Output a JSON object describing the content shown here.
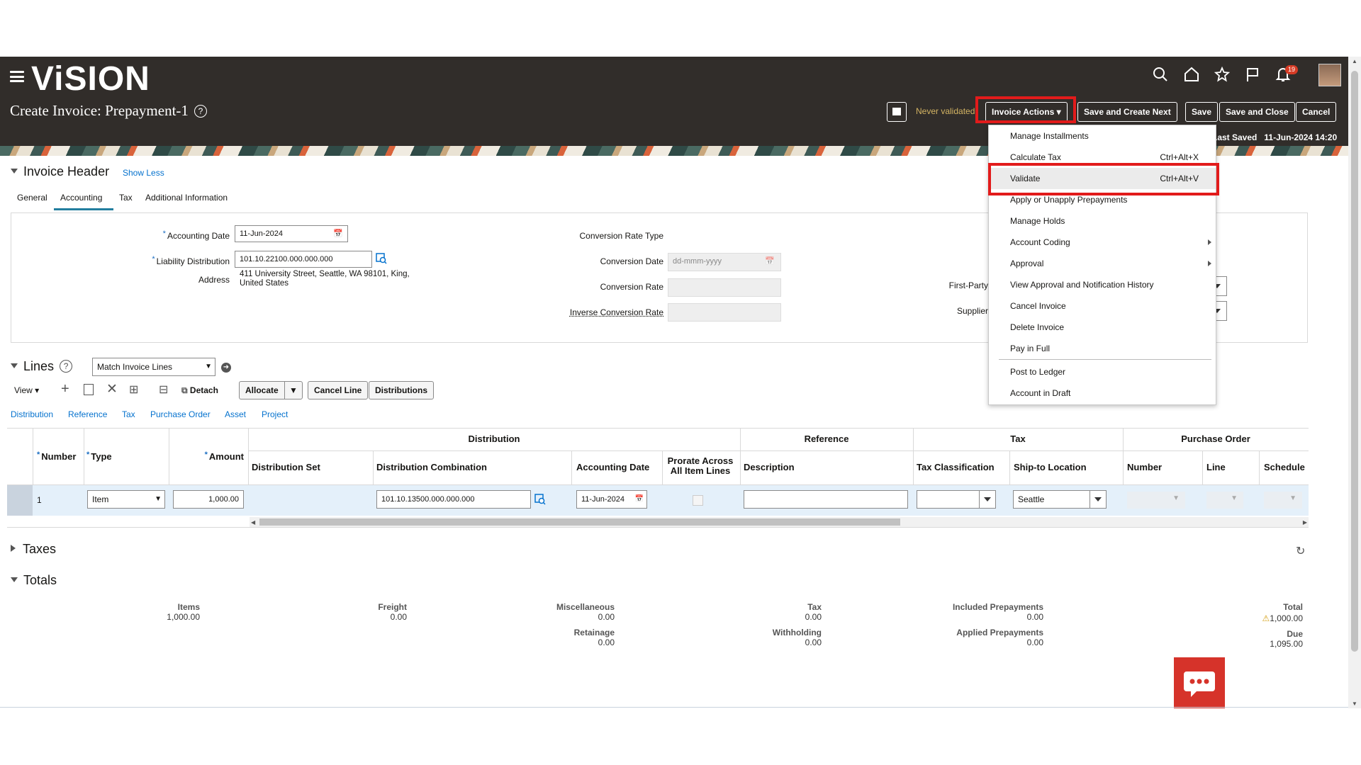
{
  "app": {
    "logo": "ViSION",
    "page_title": "Create Invoice: Prepayment-1",
    "notifications_count": "19"
  },
  "header_actions": {
    "status": "Never validated",
    "invoice_actions": "Invoice Actions",
    "save_create_next": "Save and Create Next",
    "save": "Save",
    "save_close": "Save and Close",
    "cancel": "Cancel",
    "last_saved_label": "Last Saved",
    "last_saved_value": "11-Jun-2024 14:20"
  },
  "invoice_header": {
    "title": "Invoice Header",
    "show_less": "Show Less",
    "tabs": [
      "General",
      "Accounting",
      "Tax",
      "Additional Information"
    ],
    "accounting_date_label": "Accounting Date",
    "accounting_date": "11-Jun-2024",
    "liability_label": "Liability Distribution",
    "liability_value": "101.10.22100.000.000.000",
    "address_label": "Address",
    "address_line1": "411 University Street, Seattle, WA 98101, King,",
    "address_line2": "United States",
    "conv_rate_type_label": "Conversion Rate Type",
    "conv_date_label": "Conversion Date",
    "conv_date_placeholder": "dd-mmm-yyyy",
    "conv_rate_label": "Conversion Rate",
    "inverse_rate_label": "Inverse Conversion Rate",
    "first_party_label": "First-Party",
    "supplier_label": "Supplier"
  },
  "menu": {
    "items": [
      {
        "label": "Manage Installments",
        "shortcut": ""
      },
      {
        "label": "Calculate Tax",
        "shortcut": "Ctrl+Alt+X"
      },
      {
        "label": "Validate",
        "shortcut": "Ctrl+Alt+V"
      },
      {
        "label": "Apply or Unapply Prepayments",
        "shortcut": ""
      },
      {
        "label": "Manage Holds",
        "shortcut": ""
      },
      {
        "label": "Account Coding",
        "shortcut": ""
      },
      {
        "label": "Approval",
        "shortcut": ""
      },
      {
        "label": "View Approval and Notification History",
        "shortcut": ""
      },
      {
        "label": "Cancel Invoice",
        "shortcut": ""
      },
      {
        "label": "Delete Invoice",
        "shortcut": ""
      },
      {
        "label": "Pay in Full",
        "shortcut": ""
      },
      {
        "label": "Post to Ledger",
        "shortcut": ""
      },
      {
        "label": "Account in Draft",
        "shortcut": ""
      }
    ]
  },
  "lines": {
    "title": "Lines",
    "match_select": "Match Invoice Lines",
    "view": "View",
    "detach": "Detach",
    "allocate": "Allocate",
    "cancel_line": "Cancel Line",
    "distributions": "Distributions",
    "subtabs": [
      "Distribution",
      "Reference",
      "Tax",
      "Purchase Order",
      "Asset",
      "Project"
    ],
    "groups": {
      "distribution": "Distribution",
      "reference": "Reference",
      "tax": "Tax",
      "po": "Purchase Order"
    },
    "columns": {
      "number": "Number",
      "type": "Type",
      "amount": "Amount",
      "dist_set": "Distribution Set",
      "dist_comb": "Distribution Combination",
      "acct_date": "Accounting Date",
      "prorate_1": "Prorate Across",
      "prorate_2": "All Item Lines",
      "description": "Description",
      "tax_class": "Tax Classification",
      "ship_to": "Ship-to Location",
      "po_number": "Number",
      "po_line": "Line",
      "po_schedule": "Schedule"
    },
    "row": {
      "number": "1",
      "type": "Item",
      "amount": "1,000.00",
      "dist_comb": "101.10.13500.000.000.000",
      "acct_date": "11-Jun-2024",
      "ship_to": "Seattle"
    }
  },
  "taxes": {
    "title": "Taxes"
  },
  "totals": {
    "title": "Totals",
    "items_label": "Items",
    "items": "1,000.00",
    "freight_label": "Freight",
    "freight": "0.00",
    "misc_label": "Miscellaneous",
    "misc": "0.00",
    "retainage_label": "Retainage",
    "retainage": "0.00",
    "tax_label": "Tax",
    "tax": "0.00",
    "withholding_label": "Withholding",
    "withholding": "0.00",
    "inc_prepay_label": "Included Prepayments",
    "inc_prepay": "0.00",
    "app_prepay_label": "Applied Prepayments",
    "app_prepay": "0.00",
    "total_label": "Total",
    "total": "1,000.00",
    "due_label": "Due",
    "due": "1,095.00"
  },
  "colors": {
    "header_bg": "#312d2a",
    "link": "#0572ce",
    "highlight": "#e21b1b",
    "chat": "#d6332a"
  }
}
